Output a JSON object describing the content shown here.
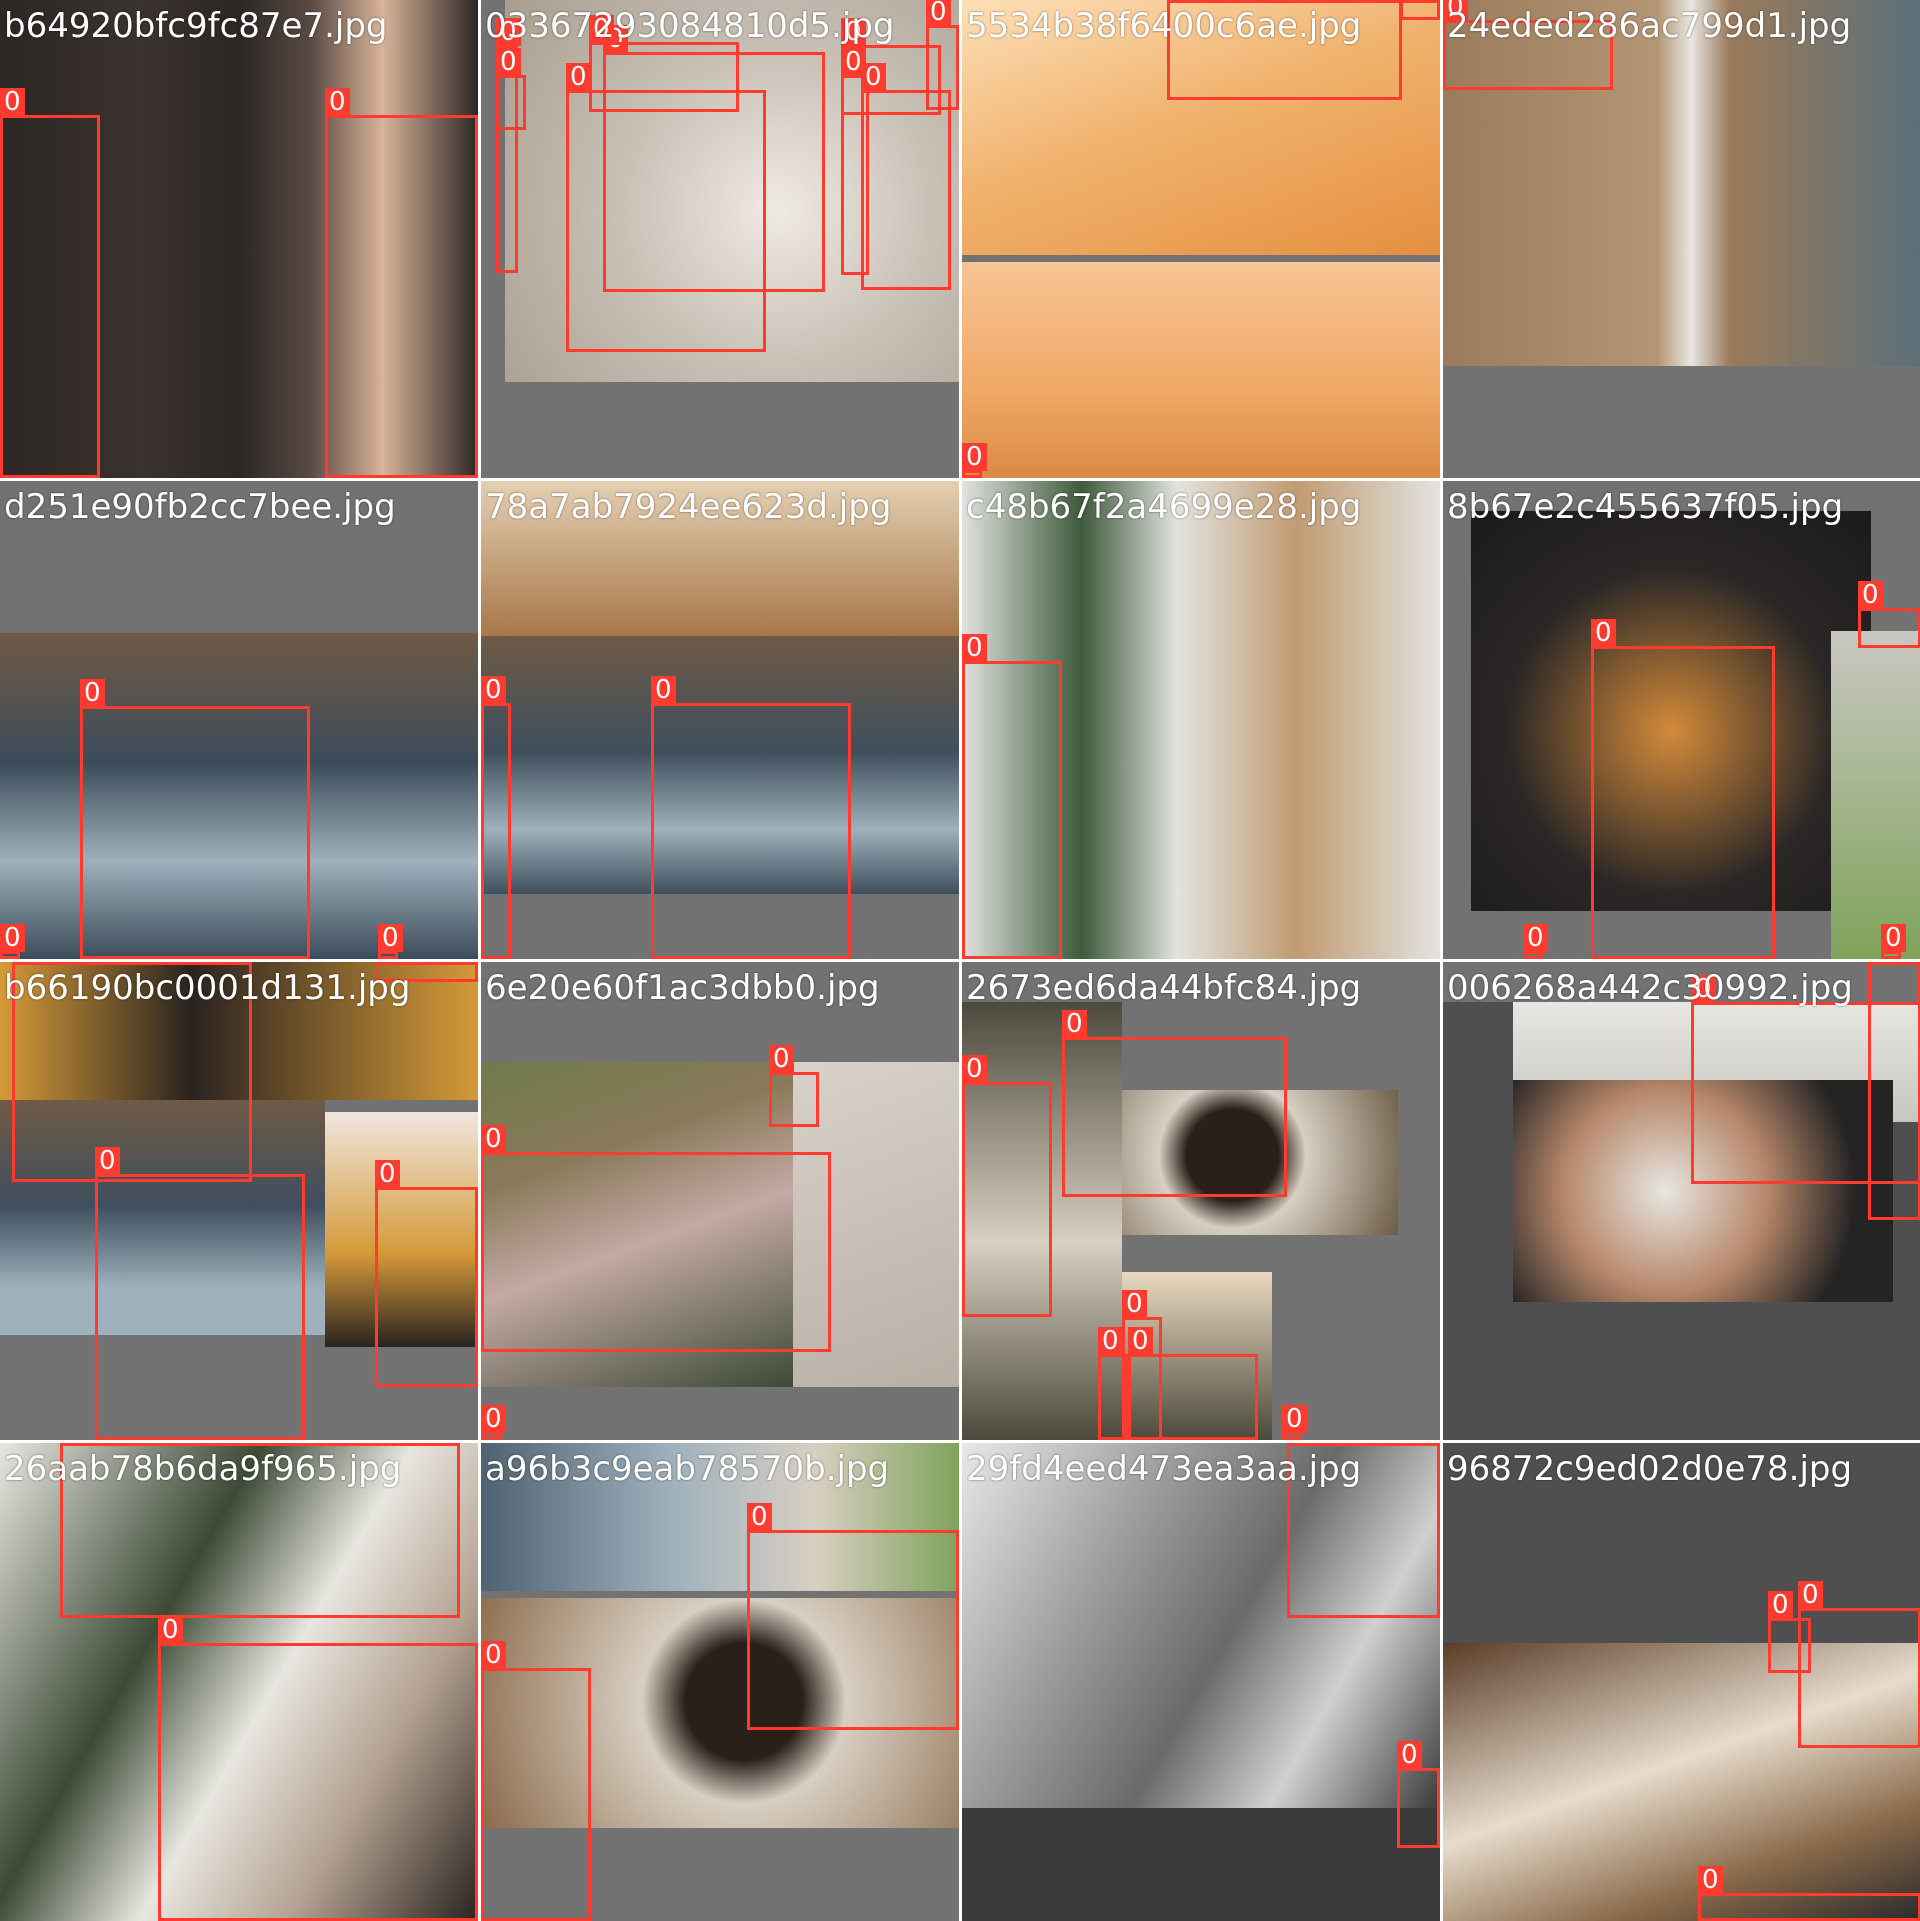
{
  "mosaic": {
    "background_gray": "#727272",
    "box_color": "#ff3b30",
    "tiles": [
      {
        "filename": "b64920bfc9fc87e7.jpg",
        "photo_colors": [
          "#2b2724",
          "#5a4a44",
          "#d9b39a"
        ],
        "box_labels": [
          "0",
          "0"
        ]
      },
      {
        "filename": "03367293084810d5.jpg",
        "photo_colors": [
          "#c9c1b6",
          "#a89d90",
          "#efeae3"
        ],
        "box_labels": [
          "0",
          "0",
          "0",
          "0",
          "0",
          "0",
          "0",
          "0",
          "0"
        ]
      },
      {
        "filename": "5534b38f6400c6ae.jpg",
        "photo_colors": [
          "#f0b36f",
          "#e68f3f",
          "#fde0b8"
        ],
        "box_labels": [
          "0",
          "0",
          "0",
          "0"
        ]
      },
      {
        "filename": "24eded286ac799d1.jpg",
        "photo_colors": [
          "#9a7b5b",
          "#e9e6e1",
          "#5b6f7a"
        ],
        "box_labels": [
          "0"
        ]
      },
      {
        "filename": "d251e90fb2cc7bee.jpg",
        "photo_colors": [
          "#3c4c5b",
          "#6f5a45",
          "#9fb1bd"
        ],
        "box_labels": [
          "0",
          "0",
          "0"
        ]
      },
      {
        "filename": "78a7ab7924ee623d.jpg",
        "photo_colors": [
          "#a8774a",
          "#3f4f5e",
          "#e4d0b3"
        ],
        "box_labels": [
          "0",
          "0"
        ]
      },
      {
        "filename": "c48b67f2a4699e28.jpg",
        "photo_colors": [
          "#e2e3df",
          "#3e5a3c",
          "#c19b72"
        ],
        "box_labels": [
          "0"
        ]
      },
      {
        "filename": "8b67e2c455637f05.jpg",
        "photo_colors": [
          "#2a2726",
          "#d38a3a",
          "#c9c7c2"
        ],
        "box_labels": [
          "0",
          "0",
          "0",
          "0"
        ]
      },
      {
        "filename": "b66190bc0001d131.jpg",
        "photo_colors": [
          "#d59a38",
          "#2a2320",
          "#3f4f5e"
        ],
        "box_labels": [
          "0",
          "0",
          "0",
          "0"
        ]
      },
      {
        "filename": "6e20e60f1ac3dbb0.jpg",
        "photo_colors": [
          "#8a7a5a",
          "#c4a9a5",
          "#d9d2ca"
        ],
        "box_labels": [
          "0",
          "0",
          "0"
        ]
      },
      {
        "filename": "2673ed6da44bfc84.jpg",
        "photo_colors": [
          "#4c4a3c",
          "#2a1f19",
          "#d7cfc2"
        ],
        "box_labels": [
          "0",
          "0",
          "0",
          "0",
          "0",
          "0"
        ]
      },
      {
        "filename": "006268a442c30992.jpg",
        "photo_colors": [
          "#242424",
          "#b7876a",
          "#e8e6e1"
        ],
        "box_labels": [
          "0",
          "0"
        ]
      },
      {
        "filename": "26aab78b6da9f965.jpg",
        "photo_colors": [
          "#e8e6e0",
          "#3c4a35",
          "#b3a190"
        ],
        "box_labels": [
          "0",
          "0"
        ]
      },
      {
        "filename": "a96b3c9eab78570b.jpg",
        "photo_colors": [
          "#4e6271",
          "#2a1f19",
          "#d8cfc2"
        ],
        "box_labels": [
          "0",
          "0"
        ]
      },
      {
        "filename": "29fd4eed473ea3aa.jpg",
        "photo_colors": [
          "#d0d0d0",
          "#6a6a6a",
          "#3a3a3a"
        ],
        "box_labels": [
          "0",
          "0"
        ]
      },
      {
        "filename": "96872c9ed02d0e78.jpg",
        "photo_colors": [
          "#5a3d28",
          "#e7dccc",
          "#2b2b2b"
        ],
        "box_labels": [
          "0",
          "0",
          "0"
        ]
      }
    ]
  }
}
